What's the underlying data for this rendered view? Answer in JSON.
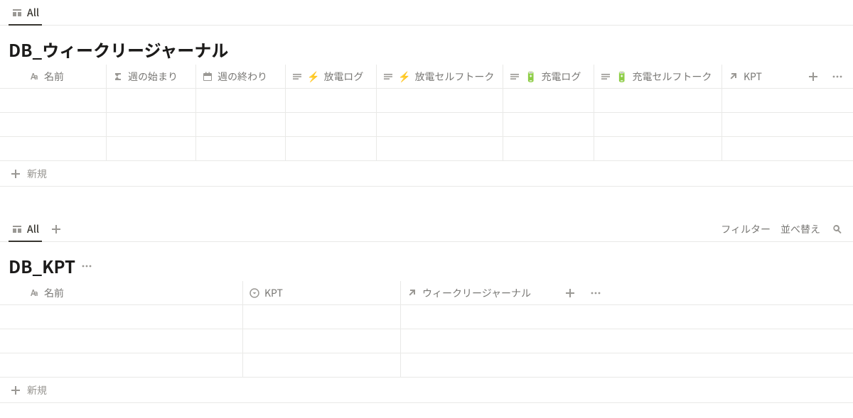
{
  "db1": {
    "tab_label": "All",
    "title": "DB_ウィークリージャーナル",
    "columns": [
      {
        "type": "title",
        "label": "名前"
      },
      {
        "type": "formula",
        "label": "週の始まり"
      },
      {
        "type": "date",
        "label": "週の終わり"
      },
      {
        "type": "text",
        "emoji": "⚡",
        "label": "放電ログ"
      },
      {
        "type": "text",
        "emoji": "⚡",
        "label": "放電セルフトーク"
      },
      {
        "type": "text",
        "emoji": "🔋",
        "label": "充電ログ"
      },
      {
        "type": "text",
        "emoji": "🔋",
        "label": "充電セルフトーク"
      },
      {
        "type": "relation",
        "label": "KPT"
      }
    ],
    "new_label": "新規",
    "empty_rows": 3
  },
  "db2": {
    "tab_label": "All",
    "filter_label": "フィルター",
    "sort_label": "並べ替え",
    "title": "DB_KPT",
    "columns": [
      {
        "type": "title",
        "label": "名前"
      },
      {
        "type": "select",
        "label": "KPT"
      },
      {
        "type": "relation",
        "label": "ウィークリージャーナル"
      }
    ],
    "new_label": "新規",
    "empty_rows": 3
  }
}
